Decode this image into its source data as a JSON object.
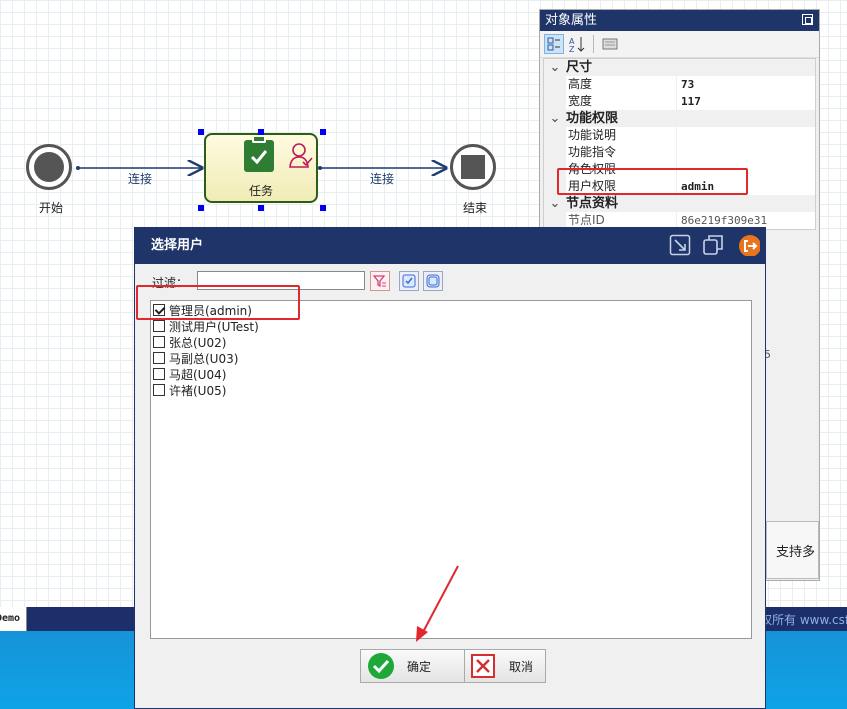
{
  "diagram": {
    "start_label": "开始",
    "end_label": "结束",
    "task_label": "任务",
    "edge1_label": "连接",
    "edge2_label": "连接"
  },
  "properties_panel": {
    "title": "对象属性",
    "categories": [
      {
        "name": "尺寸",
        "rows": [
          {
            "name": "高度",
            "value": "73"
          },
          {
            "name": "宽度",
            "value": "117"
          }
        ]
      },
      {
        "name": "功能权限",
        "rows": [
          {
            "name": "功能说明",
            "value": ""
          },
          {
            "name": "功能指令",
            "value": ""
          },
          {
            "name": "角色权限",
            "value": ""
          },
          {
            "name": "用户权限",
            "value": "admin"
          }
        ]
      },
      {
        "name": "节点资料",
        "rows": [
          {
            "name": "节点ID",
            "value": "86e219f309e31"
          }
        ]
      }
    ],
    "support_label": "支持多",
    "partial_value": "5"
  },
  "dialog": {
    "title": "选择用户",
    "filter_label": "过滤：",
    "filter_value": "",
    "users": [
      {
        "label": "管理员(admin)",
        "checked": true
      },
      {
        "label": "测试用户(UTest)",
        "checked": false
      },
      {
        "label": "张总(U02)",
        "checked": false
      },
      {
        "label": "马副总(U03)",
        "checked": false
      },
      {
        "label": "马超(U04)",
        "checked": false
      },
      {
        "label": "许褚(U05)",
        "checked": false
      }
    ],
    "ok_label": "确定",
    "cancel_label": "取消"
  },
  "status_bar": {
    "tab_label": "Demo",
    "copyright": "权所有 www.csfr"
  },
  "colors": {
    "title_bar": "#1f3569",
    "annotation_red": "#e0282d",
    "task_green": "#2e7d32",
    "bottom_blue": "#0ea3e6"
  }
}
